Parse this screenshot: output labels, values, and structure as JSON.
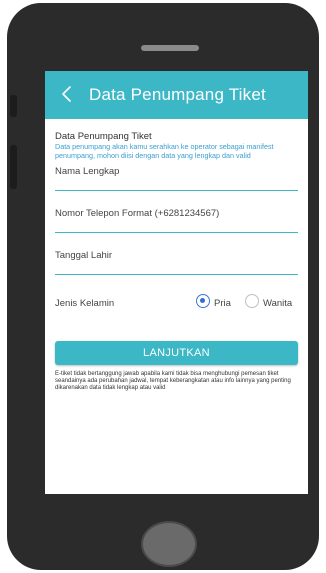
{
  "appbar": {
    "back_icon": "chevron-left-icon",
    "title": "Data Penumpang Tiket"
  },
  "form": {
    "section_title": "Data Penumpang Tiket",
    "section_desc": "Data penumpang akan kamu serahkan ke operator sebagai manifest penumpang, mohon diisi dengan data yang lengkap dan valid",
    "name_placeholder": "Nama Lengkap",
    "phone_placeholder": "Nomor Telepon Format (+6281234567)",
    "dob_placeholder": "Tanggal Lahir",
    "gender_label": "Jenis Kelamin",
    "gender_options": [
      "Pria",
      "Wanita"
    ],
    "gender_selected": "Pria"
  },
  "actions": {
    "submit_label": "LANJUTKAN"
  },
  "disclaimer": "E-tiket tidak bertanggung jawab apabila kami tidak bisa menghubungi pemesan tiket seandainya ada perubahan jadwal, tempat keberangkatan atau info lainnya yang penting dikarenakan data tidak lengkap atau valid",
  "colors": {
    "accent": "#3cb7c6",
    "link_text": "#3a9fd0",
    "radio_selected": "#2f6fd4",
    "phone_frame": "#2b2b2b"
  }
}
